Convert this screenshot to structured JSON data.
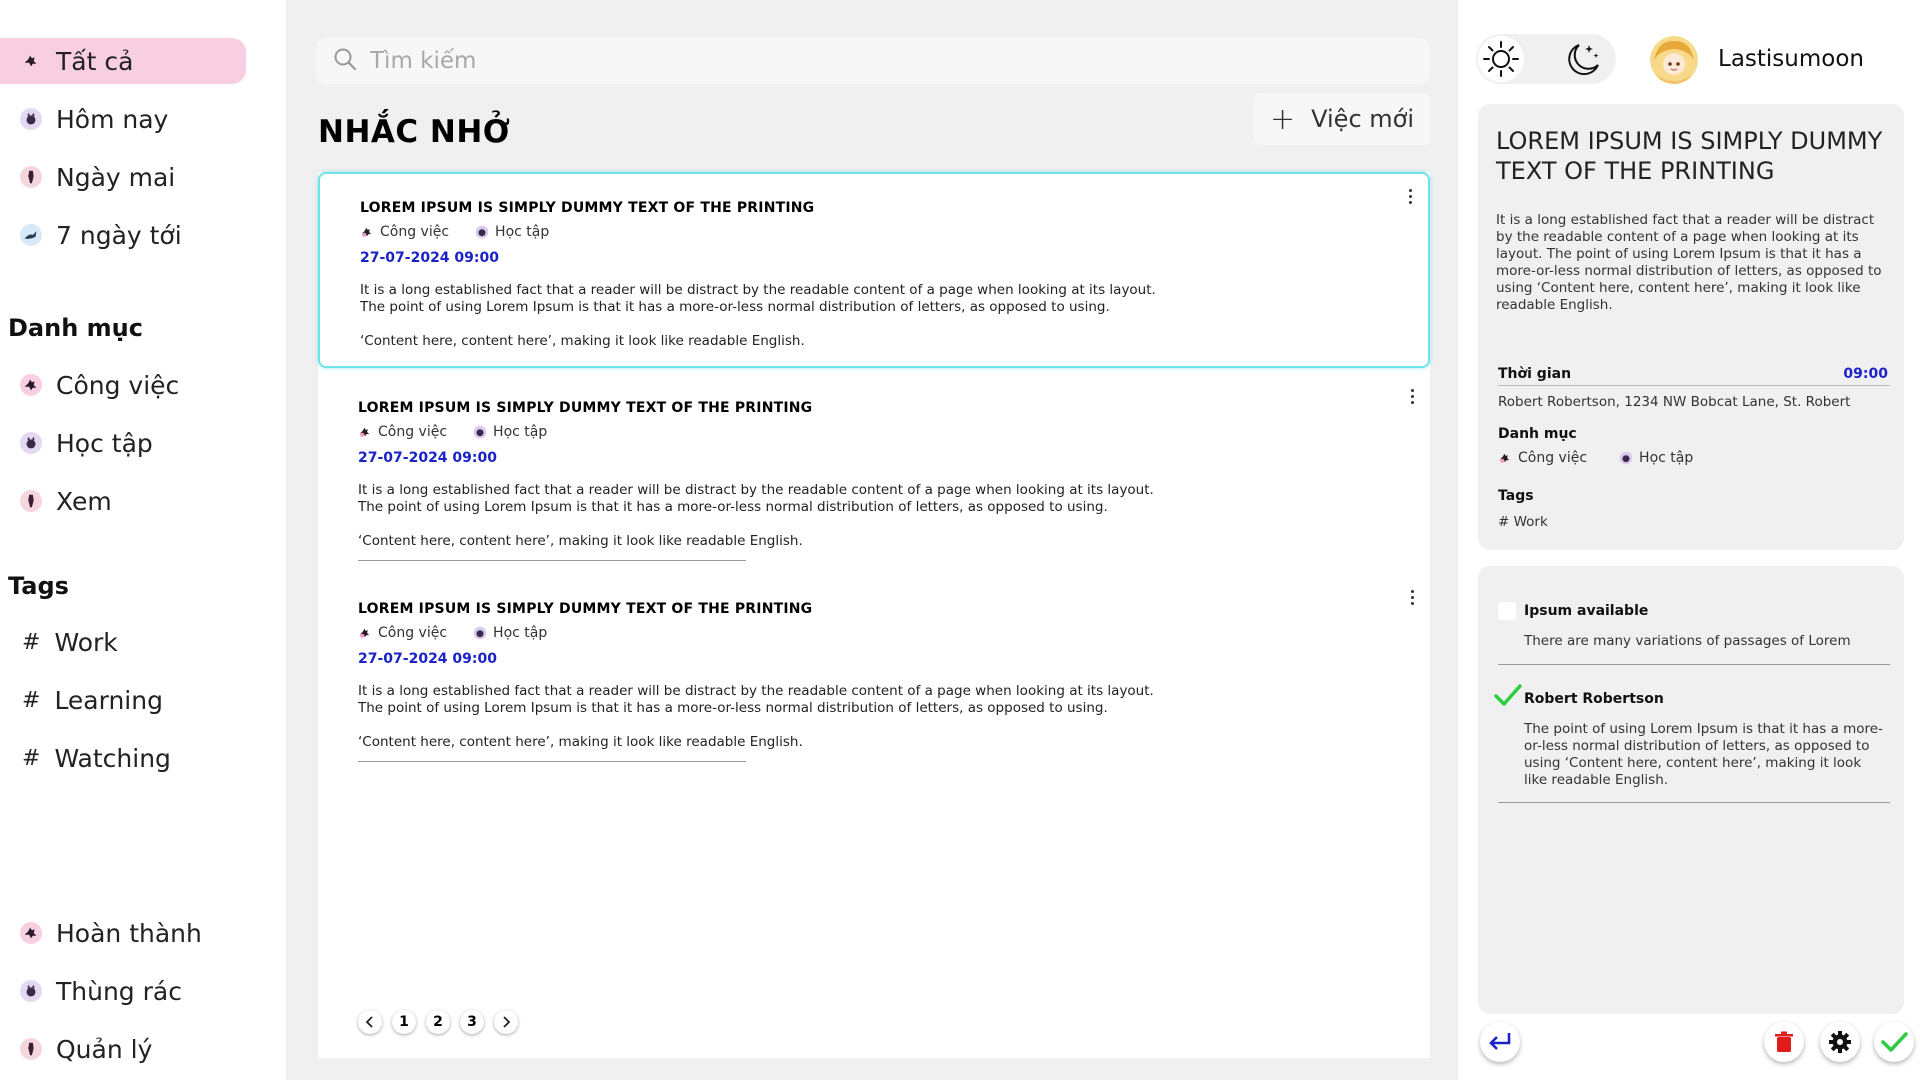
{
  "sidebar": {
    "nav": [
      {
        "label": "Tất cả",
        "icon": "cat-icon",
        "active": true
      },
      {
        "label": "Hôm nay",
        "icon": "cat-icon"
      },
      {
        "label": "Ngày mai",
        "icon": "cat-icon"
      },
      {
        "label": "7 ngày tới",
        "icon": "cat-icon"
      }
    ],
    "categories_title": "Danh mục",
    "categories": [
      {
        "label": "Công việc",
        "icon": "cat-icon"
      },
      {
        "label": "Học tập",
        "icon": "cat-icon"
      },
      {
        "label": "Xem",
        "icon": "cat-icon"
      }
    ],
    "tags_title": "Tags",
    "tags": [
      {
        "hash": "#",
        "label": "Work"
      },
      {
        "hash": "#",
        "label": "Learning"
      },
      {
        "hash": "#",
        "label": "Watching"
      }
    ],
    "bottom": [
      {
        "label": "Hoàn thành",
        "icon": "cat-icon"
      },
      {
        "label": "Thùng rác",
        "icon": "cat-icon"
      },
      {
        "label": "Quản lý",
        "icon": "cat-icon"
      }
    ]
  },
  "main": {
    "search_placeholder": "Tìm kiếm",
    "title": "NHẮC NHỞ",
    "new_task_icon": "+",
    "new_task_label": "Việc mới",
    "tasks": [
      {
        "title": "LOREM IPSUM IS SIMPLY DUMMY TEXT OF THE PRINTING",
        "cat1": "Công việc",
        "cat2": "Học tập",
        "datetime": "27-07-2024 09:00",
        "body1": "It is a long established fact that a reader will be distract by the readable content of a page when looking at its layout.",
        "body2": "The point of using Lorem Ipsum is that it has  a more-or-less normal distribution of letters, as opposed to using.",
        "body3": "‘Content here, content here’, making it look like readable English.",
        "selected": true
      },
      {
        "title": "LOREM IPSUM IS SIMPLY DUMMY TEXT OF THE PRINTING",
        "cat1": "Công việc",
        "cat2": "Học tập",
        "datetime": "27-07-2024 09:00",
        "body1": "It is a long established fact that a reader will be distract by the readable content of a page when looking at its layout.",
        "body2": "The point of using Lorem Ipsum is that it has  a more-or-less normal distribution of letters, as opposed to using.",
        "body3": "‘Content here, content here’, making it look like readable English."
      },
      {
        "title": "LOREM IPSUM IS SIMPLY DUMMY TEXT OF THE PRINTING",
        "cat1": "Công việc",
        "cat2": "Học tập",
        "datetime": "27-07-2024 09:00",
        "body1": "It is a long established fact that a reader will be distract by the readable content of a page when looking at its layout.",
        "body2": "The point of using Lorem Ipsum is that it has  a more-or-less normal distribution of letters, as opposed to using.",
        "body3": "‘Content here, content here’, making it look like readable English."
      }
    ],
    "pagination": {
      "pages": [
        "1",
        "2",
        "3"
      ],
      "prev_icon": "chevron-left-icon",
      "next_icon": "chevron-right-icon"
    }
  },
  "right": {
    "theme_icons": [
      "sun-icon",
      "moon-icon"
    ],
    "username": "Lastisumoon",
    "detail": {
      "title": "LOREM IPSUM IS SIMPLY DUMMY TEXT OF THE PRINTING",
      "description": "It is a long established fact that a reader will be distract by the readable content of a page when looking at its layout. The point of using Lorem Ipsum is that it has a more-or-less normal distribution of letters, as opposed to using ‘Content here, content here’, making it look like readable English.",
      "time_label": "Thời gian",
      "time_value": "09:00",
      "address": "Robert Robertson, 1234 NW Bobcat Lane, St. Robert",
      "category_label": "Danh mục",
      "cat1": "Công việc",
      "cat2": "Học tập",
      "tags_label": "Tags",
      "tag": "# Work"
    },
    "subtasks": [
      {
        "title": "Ipsum available",
        "body": "There are many variations of passages of Lorem",
        "checked": false
      },
      {
        "title": "Robert Robertson",
        "body": "The point of using Lorem Ipsum is that it has a more-or-less normal distribution of letters, as opposed to using ‘Content here, content here’, making it look like readable English.",
        "checked": true
      }
    ],
    "actions": [
      "back-icon",
      "trash-icon",
      "gear-icon",
      "check-icon"
    ]
  },
  "colors": {
    "active_nav": "#f8cfe0",
    "date_blue": "#1a22c8",
    "selected_border": "#6fe3ea",
    "check_green": "#2ecc40",
    "trash_red": "#e01b1b",
    "back_blue": "#1a22c8"
  }
}
